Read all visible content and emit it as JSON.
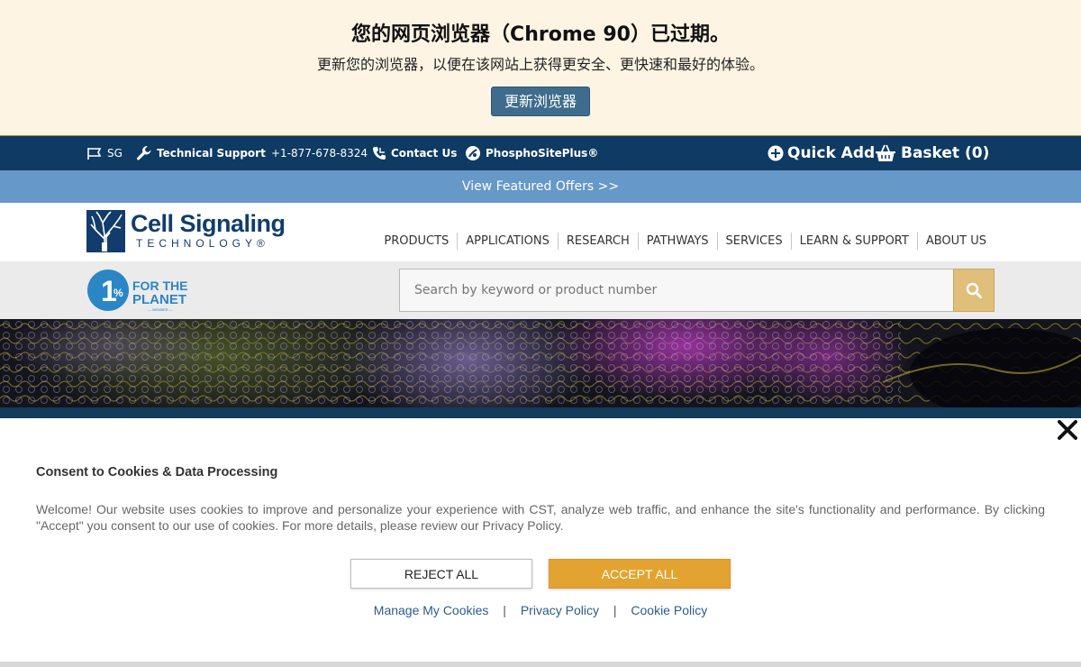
{
  "banner": {
    "title": "您的网页浏览器（Chrome 90）已过期。",
    "subtitle": "更新您的浏览器，以便在该网站上获得更安全、更快速和最好的体验。",
    "update_label": "更新浏览器"
  },
  "utility": {
    "region": "SG",
    "tech_support": "Technical Support",
    "phone": "+1-877-678-8324",
    "contact": "Contact Us",
    "phosphosite": "PhosphoSitePlus®",
    "quick_add": "Quick Add",
    "basket": "Basket (0)"
  },
  "offers": {
    "label": "View Featured Offers >>"
  },
  "logo": {
    "main": "Cell Signaling",
    "sub": "TECHNOLOGY®"
  },
  "nav": {
    "items": [
      {
        "label": "PRODUCTS"
      },
      {
        "label": "APPLICATIONS"
      },
      {
        "label": "RESEARCH"
      },
      {
        "label": "PATHWAYS"
      },
      {
        "label": "SERVICES"
      },
      {
        "label": "LEARN & SUPPORT"
      },
      {
        "label": "ABOUT US"
      }
    ]
  },
  "planet": {
    "line1": "FOR THE",
    "line2": "PLANET",
    "line3": "— MEMBER —",
    "pct": "1%"
  },
  "search": {
    "placeholder": "Search by keyword or product number"
  },
  "cookie": {
    "title": "Consent to Cookies & Data Processing",
    "text": "Welcome! Our website uses cookies to improve and personalize your experience with CST, analyze web traffic, and enhance the site's functionality and performance. By clicking \"Accept\" you consent to our use of cookies. For more details, please review our Privacy Policy.",
    "reject": "REJECT ALL",
    "accept": "ACCEPT ALL",
    "links": {
      "manage": "Manage My Cookies",
      "privacy": "Privacy Policy",
      "cookie_policy": "Cookie Policy",
      "separator": "|"
    }
  },
  "colors": {
    "banner_bg": "#fdf4e4",
    "utility_bg": "#0e3a63",
    "offers_bg": "#6698c8",
    "brand_navy": "#123c6b",
    "accent_gold": "#e3a331",
    "search_btn": "#e0bf7a"
  },
  "icons": {
    "region": "flag-icon",
    "tech_support": "wrench-icon",
    "contact": "phone-icon",
    "phosphosite": "phosphosite-icon",
    "quick_add": "plus-circle-icon",
    "basket": "basket-icon",
    "search": "search-icon",
    "close": "close-icon"
  }
}
